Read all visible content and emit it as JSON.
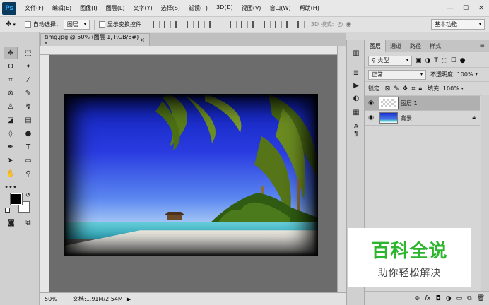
{
  "app": {
    "logo": "Ps"
  },
  "menu": [
    "文件(F)",
    "编辑(E)",
    "图像(I)",
    "图层(L)",
    "文字(Y)",
    "选择(S)",
    "滤镜(T)",
    "3D(D)",
    "视图(V)",
    "窗口(W)",
    "帮助(H)"
  ],
  "window_controls": {
    "minimize": "—",
    "maximize": "☐",
    "close": "✕"
  },
  "options_bar": {
    "auto_select_label": "自动选择：",
    "auto_select_value": "图层",
    "show_transform_label": "显示变换控件",
    "mode_3d_label": "3D 模式:",
    "workspace": "基本功能"
  },
  "document": {
    "tab_title": "timg.jpg @ 50% (图层 1, RGB/8#)",
    "tab_modified": "*",
    "tab_close": "×",
    "zoom": "50%",
    "doc_info": "文档:1.91M/2.54M"
  },
  "panel": {
    "tabs": [
      "图层",
      "通道",
      "路径",
      "样式"
    ],
    "filter_kind": "类型",
    "blend_mode": "正常",
    "opacity_label": "不透明度:",
    "opacity_value": "100%",
    "lock_label": "锁定:",
    "fill_label": "填充:",
    "fill_value": "100%",
    "layers": [
      {
        "name": "图层 1",
        "selected": true,
        "locked": false
      },
      {
        "name": "背景",
        "selected": false,
        "locked": true
      }
    ]
  },
  "watermark": {
    "title": "百科全说",
    "subtitle": "助你轻松解决"
  },
  "colors": {
    "foreground": "#000000",
    "background": "#ffffff",
    "accent_green": "#2db52d"
  }
}
